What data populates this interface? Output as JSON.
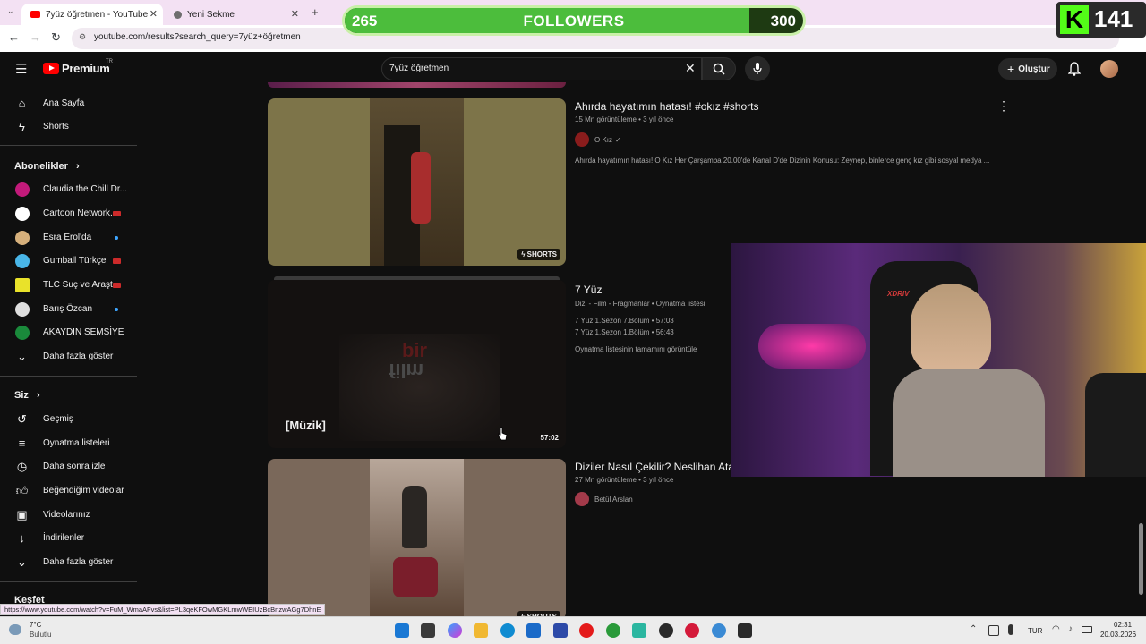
{
  "browser": {
    "tabs": [
      {
        "title": "7yüz öğretmen - YouTube",
        "active": true
      },
      {
        "title": "Yeni Sekme",
        "active": false
      }
    ],
    "url": "youtube.com/results?search_query=7yüz+öğretmen",
    "status_url": "https://www.youtube.com/watch?v=FuM_WmaAFvs&list=PL3qeKFOwMGKLmwWEIUzBcBnzwAGg7DhnE"
  },
  "overlay": {
    "followers_current": "265",
    "followers_label": "FOLLOWERS",
    "followers_goal": "300",
    "followers_progress": 0.883,
    "kick_logo": "K",
    "kick_count": "141"
  },
  "header": {
    "logo_text": "Premium",
    "logo_region": "TR",
    "search_value": "7yüz öğretmen",
    "create_label": "Oluştur"
  },
  "sidebar": {
    "home": "Ana Sayfa",
    "shorts": "Shorts",
    "subs_title": "Abonelikler",
    "subs_chevron": "›",
    "subscriptions": [
      {
        "name": "Claudia the Chill Dr...",
        "status": "live",
        "color": "#c21a7a"
      },
      {
        "name": "Cartoon Network...",
        "status": "live",
        "color": "#ffffff"
      },
      {
        "name": "Esra Erol'da",
        "status": "new",
        "color": "#d6b07c"
      },
      {
        "name": "Gumball Türkçe",
        "status": "live",
        "color": "#49b6e8"
      },
      {
        "name": "TLC Suç ve Araşt...",
        "status": "live",
        "color": "#e9e22a"
      },
      {
        "name": "Barış Özcan",
        "status": "new",
        "color": "#dedede"
      },
      {
        "name": "AKAYDIN SEMSİYE",
        "status": "",
        "color": "#1a8a3b"
      }
    ],
    "show_more": "Daha fazla göster",
    "you_title": "Siz",
    "you_chevron": "›",
    "you_items": [
      {
        "label": "Geçmiş",
        "icon": "history-icon"
      },
      {
        "label": "Oynatma listeleri",
        "icon": "playlists-icon"
      },
      {
        "label": "Daha sonra izle",
        "icon": "watch-later-icon"
      },
      {
        "label": "Beğendiğim videolar",
        "icon": "like-icon"
      },
      {
        "label": "Videolarınız",
        "icon": "your-videos-icon"
      },
      {
        "label": "İndirilenler",
        "icon": "download-icon"
      }
    ],
    "show_more_2": "Daha fazla göster",
    "explore_title": "Keşfet"
  },
  "results": [
    {
      "title": "Ahırda hayatımın hatası! #okız #shorts",
      "meta": "15 Mn görüntüleme • 3 yıl önce",
      "channel": "O Kız",
      "description": "Ahırda hayatımın hatası! O Kız Her Çarşamba 20.00'de Kanal D'de Dizinin Konusu: Zeynep, binlerce genç kız gibi sosyal medya ...",
      "badge": "SHORTS"
    },
    {
      "title": "7 Yüz",
      "meta": "Dizi - Film - Fragmanlar • Oynatma listesi",
      "line1": "7 Yüz 1.Sezon 7.Bölüm • 57:03",
      "line2": "7 Yüz 1.Sezon 1.Bölüm • 56:43",
      "full_playlist": "Oynatma listesinin tamamını görüntüle",
      "caption": "[Müzik]",
      "watermark_1": "bir",
      "watermark_2": "film",
      "duration": "57:02"
    },
    {
      "title": "Diziler Nasıl Çekilir? Neslihan Ata",
      "meta": "27 Mn görüntüleme • 3 yıl önce",
      "channel": "Betül Arslan",
      "badge": "SHORTS"
    }
  ],
  "webcam": {
    "chair_brand": "XDRIV"
  },
  "taskbar": {
    "temp": "7°C",
    "weather": "Bulutlu",
    "lang": "TUR",
    "time": "02:31",
    "date": "20.03.2026"
  }
}
